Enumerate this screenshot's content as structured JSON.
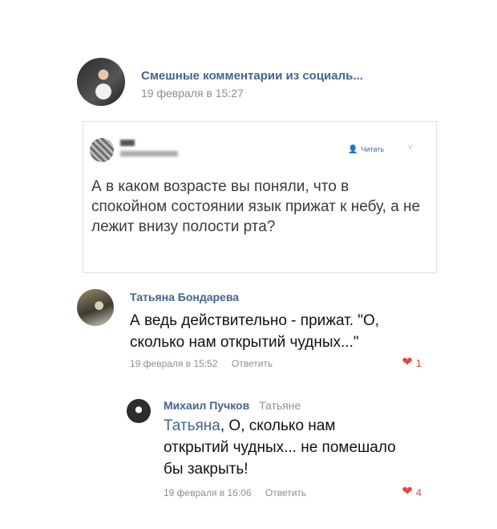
{
  "post": {
    "group_name": "Смешные комментарии из социаль...",
    "date": "19 февраля в 15:27"
  },
  "quote": {
    "follow_label": "Читать",
    "text": "А в каком возрасте вы поняли, что в спокойном состоянии язык прижат к небу, а не лежит внизу полости рта?"
  },
  "comments": [
    {
      "author": "Татьяна Бондарева",
      "text": "А ведь действительно - прижат. \"О, сколько нам открытий чудных...\"",
      "date": "19 февраля в 15:52",
      "reply_label": "Ответить",
      "likes": "1"
    },
    {
      "author": "Михаил Пучков",
      "reply_to": "Татьяне",
      "mention": "Татьяна",
      "text": ", О, сколько нам открытий чудных... не помешало бы закрыть!",
      "date": "19 февраля в 16:06",
      "reply_label": "Ответить",
      "likes": "4"
    }
  ],
  "colors": {
    "link": "#43648d",
    "meta": "#8a8f96",
    "like": "#e64646"
  },
  "icons": {
    "like": "heart-icon",
    "follow": "add-user-icon",
    "more": "chevron-down-icon"
  }
}
